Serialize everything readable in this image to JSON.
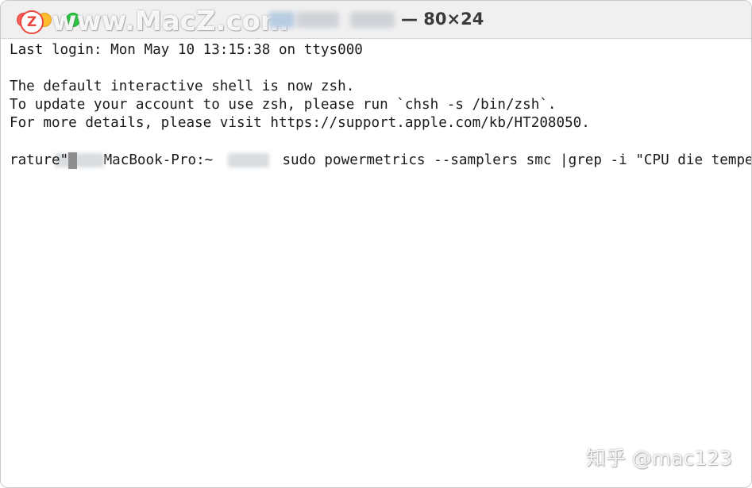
{
  "window": {
    "title_suffix": "— 80×24"
  },
  "watermarks": {
    "macz_logo": "Z",
    "macz_text": "www.MacZ.com",
    "zhihu": "知乎 @mac123"
  },
  "terminal": {
    "lines": [
      "Last login: Mon May 10 13:15:38 on ttys000",
      "",
      "The default interactive shell is now zsh.",
      "To update your account to use zsh, please run `chsh -s /bin/zsh`.",
      "For more details, please visit https://support.apple.com/kb/HT208050."
    ],
    "prompt_host": "MacBook-Pro:~",
    "command_part1": "sudo powermetrics --samplers smc |grep -i \"CPU die tempe",
    "command_part2": "rature\""
  },
  "colors": {
    "close": "#fe5f57",
    "minimize": "#febc2e",
    "zoom": "#28c840",
    "cursor": "#8e8e8e"
  }
}
